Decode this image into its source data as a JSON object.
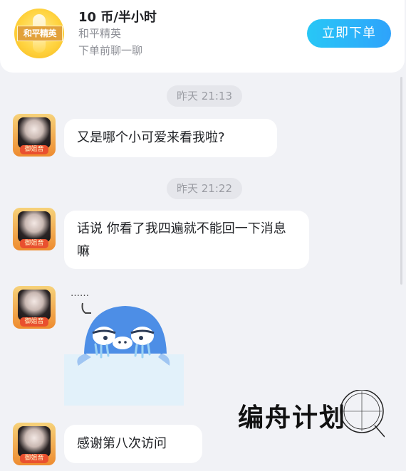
{
  "service_card": {
    "price": "10 币/半小时",
    "game_name": "和平精英",
    "tip": "下单前聊一聊",
    "icon_label": "和平精英",
    "order_button": "立即下单"
  },
  "messages": [
    {
      "type": "time",
      "text": "昨天 21:13"
    },
    {
      "type": "text",
      "text": "又是哪个小可爱来看我啦?"
    },
    {
      "type": "time",
      "text": "昨天 21:22"
    },
    {
      "type": "text",
      "text": "话说 你看了我四遍就不能回一下消息嘛"
    },
    {
      "type": "sticker",
      "icon": "crying-whale-sticker-icon",
      "text": "……"
    },
    {
      "type": "text",
      "text": "感谢第八次访问"
    }
  ],
  "avatar_badge": "御姐音",
  "watermark": "编舟计划",
  "colors": {
    "page_bg": "#f1f2f6",
    "accent_start": "#28c7f6",
    "accent_end": "#2ea3fb",
    "bubble_bg": "#ffffff",
    "time_text": "#9a9ca3"
  }
}
